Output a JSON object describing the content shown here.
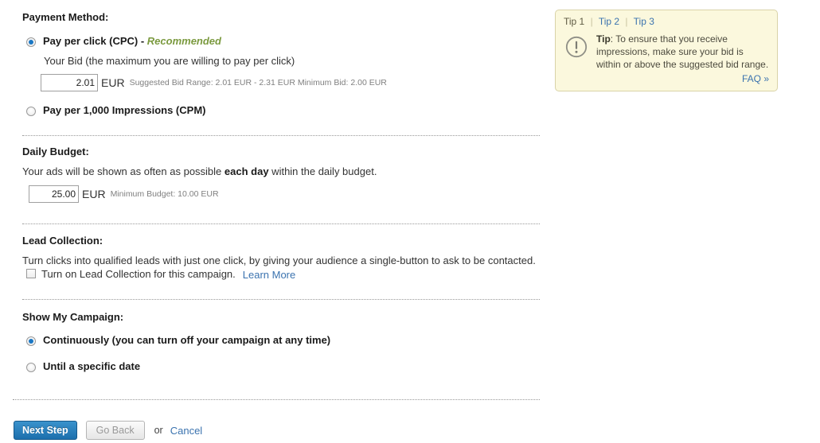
{
  "payment": {
    "title": "Payment Method:",
    "cpc_label": "Pay per click (CPC)",
    "cpc_dash": " - ",
    "cpc_recommended": "Recommended",
    "bid_caption": "Your Bid (the maximum you are willing to pay per click)",
    "bid_value": "2.01",
    "bid_currency": "EUR",
    "bid_hint": "Suggested Bid Range: 2.01 EUR - 2.31 EUR Minimum Bid: 2.00 EUR",
    "cpm_label": "Pay per 1,000 Impressions (CPM)"
  },
  "budget": {
    "title": "Daily Budget:",
    "desc_before": "Your ads will be shown as often as possible ",
    "desc_bold": "each day",
    "desc_after": " within the daily budget.",
    "value": "25.00",
    "currency": "EUR",
    "hint": "Minimum Budget: 10.00 EUR"
  },
  "lead": {
    "title": "Lead Collection:",
    "desc": "Turn clicks into qualified leads with just one click, by giving your audience a single-button to ask to be contacted.",
    "checkbox_label": "Turn on Lead Collection for this campaign.",
    "learn_more": "Learn More"
  },
  "schedule": {
    "title": "Show My Campaign:",
    "option_continuous": "Continuously (you can turn off your campaign at any time)",
    "option_until_date": "Until a specific date"
  },
  "actions": {
    "next_label": "Next Step",
    "back_label": "Go Back",
    "or_label": "or",
    "cancel_label": "Cancel"
  },
  "tip": {
    "tab1": "Tip 1",
    "tab2": "Tip 2",
    "tab3": "Tip 3",
    "sep": "|",
    "prefix": "Tip",
    "text": ": To ensure that you receive impressions, make sure your bid is within or above the suggested bid range.",
    "faq": "FAQ »"
  },
  "colors": {
    "accent_blue": "#1c6fad",
    "link_blue": "#3b73af",
    "recommended_green": "#7b9a3f",
    "tip_bg": "#fbf8dd",
    "tip_border": "#d9d3a8"
  }
}
